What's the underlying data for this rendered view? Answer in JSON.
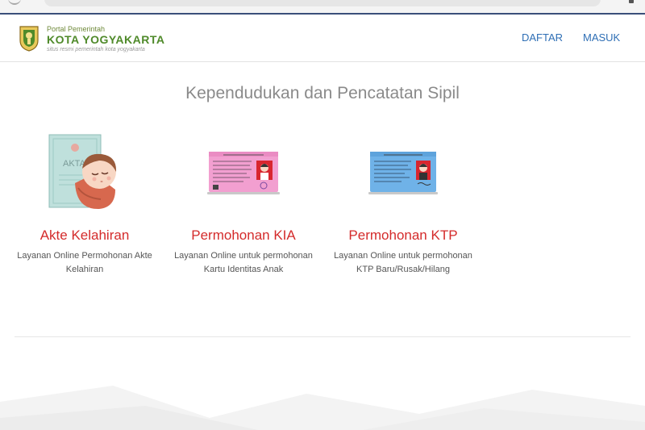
{
  "header": {
    "logo_sub": "Portal Pemerintah",
    "logo_main": "KOTA YOGYAKARTA",
    "logo_tagline": "situs resmi pemerintah kota yogyakarta",
    "nav": {
      "daftar": "DAFTAR",
      "masuk": "MASUK"
    }
  },
  "page": {
    "title": "Kependudukan dan Pencatatan Sipil"
  },
  "cards": [
    {
      "title": "Akte Kelahiran",
      "desc": "Layanan Online Permohonan Akte Kelahiran",
      "icon": "birth-certificate-baby-icon",
      "doc_label": "AKTA"
    },
    {
      "title": "Permohonan KIA",
      "desc": "Layanan Online untuk permohonan Kartu Identitas Anak",
      "icon": "kia-card-icon"
    },
    {
      "title": "Permohonan KTP",
      "desc": "Layanan Online untuk permohonan KTP Baru/Rusak/Hilang",
      "icon": "ktp-card-icon"
    }
  ],
  "colors": {
    "accent_red": "#d42b2b",
    "nav_blue": "#2f6fb5",
    "logo_green": "#4f8a2a",
    "kia_pink": "#f29fd0",
    "ktp_blue": "#6fb2e8"
  }
}
